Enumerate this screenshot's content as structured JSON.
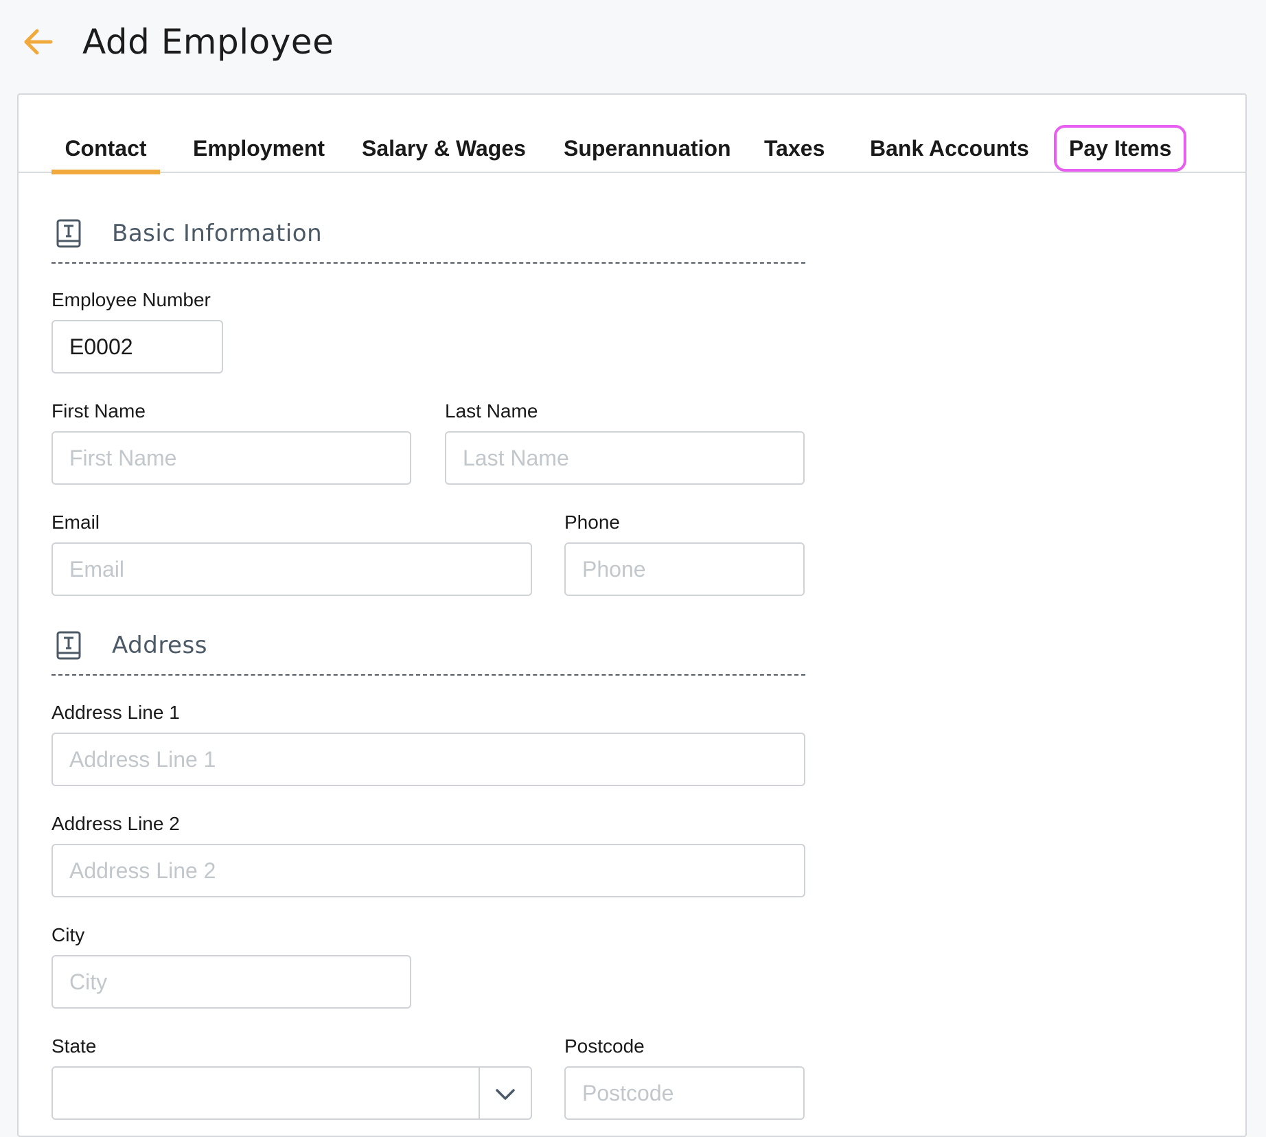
{
  "header": {
    "title": "Add Employee",
    "back_icon": "arrow-left-icon",
    "accent_color": "#f0a93a"
  },
  "tabs": [
    {
      "label": "Contact",
      "active": true
    },
    {
      "label": "Employment",
      "active": false
    },
    {
      "label": "Salary & Wages",
      "active": false
    },
    {
      "label": "Superannuation",
      "active": false
    },
    {
      "label": "Taxes",
      "active": false
    },
    {
      "label": "Bank Accounts",
      "active": false
    },
    {
      "label": "Pay Items",
      "active": false,
      "highlight_color": "#e85ef0"
    }
  ],
  "basic_info": {
    "title": "Basic Information",
    "icon": "text-document-icon",
    "employee_number": {
      "label": "Employee Number",
      "value": "E0002"
    },
    "first_name": {
      "label": "First Name",
      "placeholder": "First Name"
    },
    "last_name": {
      "label": "Last Name",
      "placeholder": "Last Name"
    },
    "email": {
      "label": "Email",
      "placeholder": "Email"
    },
    "phone": {
      "label": "Phone",
      "placeholder": "Phone"
    }
  },
  "address": {
    "title": "Address",
    "icon": "text-document-icon",
    "line1": {
      "label": "Address Line 1",
      "placeholder": "Address Line 1"
    },
    "line2": {
      "label": "Address Line 2",
      "placeholder": "Address Line 2"
    },
    "city": {
      "label": "City",
      "placeholder": "City"
    },
    "state": {
      "label": "State",
      "value": ""
    },
    "postcode": {
      "label": "Postcode",
      "placeholder": "Postcode"
    }
  }
}
